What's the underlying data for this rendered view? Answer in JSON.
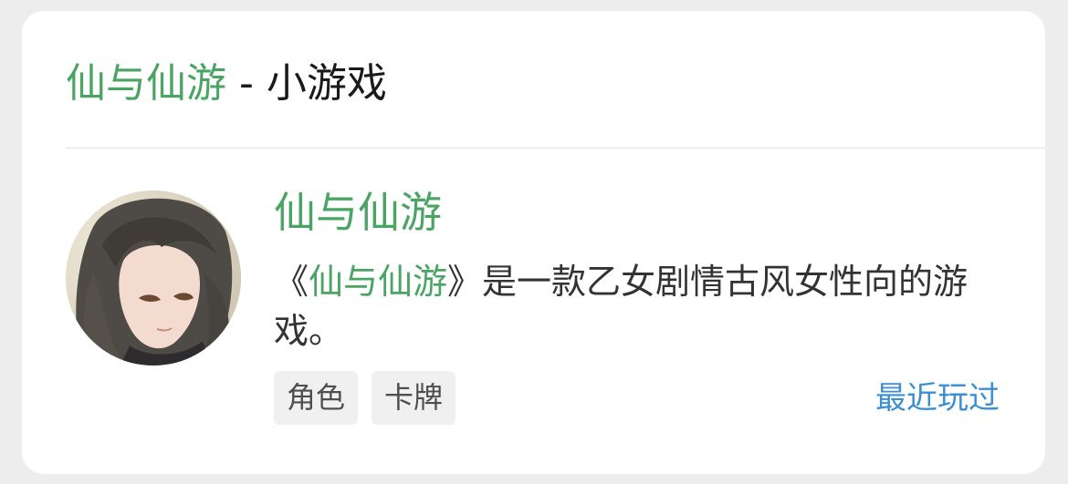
{
  "header": {
    "game_name": "仙与仙游",
    "separator": " - ",
    "kind": "小游戏"
  },
  "game": {
    "title": "仙与仙游",
    "description_prefix": "《",
    "description_name": "仙与仙游",
    "description_suffix": "》是一款乙女剧情古风女性向的游戏。",
    "avatar_icon": "game-avatar-portrait",
    "tags": [
      "角色",
      "卡牌"
    ],
    "recent_label": "最近玩过"
  },
  "colors": {
    "accent_green": "#4aa564",
    "link_blue": "#3d8fd4",
    "tag_bg": "#f0f0f0",
    "page_bg": "#ededed"
  }
}
